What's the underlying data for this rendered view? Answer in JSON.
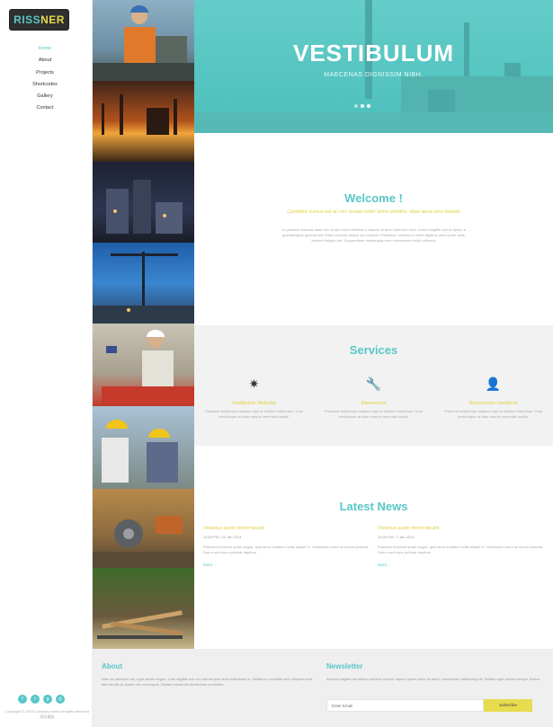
{
  "brand": {
    "part1": "RISS",
    "part2": "NER"
  },
  "nav": [
    "Home",
    "About",
    "Projects",
    "Shortcodes",
    "Gallery",
    "Contact"
  ],
  "social": [
    "f",
    "t",
    "g",
    "◎"
  ],
  "copyright": "Copyright © 2015 Company name All rights reserved 网页模板",
  "hero": {
    "title": "VESTIBULUM",
    "subtitle": "MAECENAS DIGNISSIM NIBH."
  },
  "welcome": {
    "title": "Welcome !",
    "subtitle": "Curabitur cursus est ac nec ornare tortor tortor porttitor, vitae lacus arcu blandit.",
    "body": "In placerat vehicula diam nec ornare tortor eleifend a. Mauris sit amet interdum urna. Donec sagittis cursus ipsum a gravida ligula gravida nisi. Etiam pulvinar neque non semper. Phasellus, vivamus in amet dapibus risus quam vitae, dictum tristique nisl. Suspendisse malesuada urna consectetur mollis vehicula."
  },
  "services": {
    "title": "Services",
    "items": [
      {
        "icon": "✷",
        "title": "Vestibulum Molestie",
        "text": "Praesent vestibulum dapibus nibh ut eleifend bibendum. Cras scelerisque at vitae mauris venenatis mattis."
      },
      {
        "icon": "🔧",
        "title": "Elementum",
        "text": "Praesent vestibulum dapibus nibh ut eleifend bibendum. Cras scelerisque at vitae mauris venenatis mattis."
      },
      {
        "icon": "👤",
        "title": "Nonsectetur Hendrerit",
        "text": "Praesent vestibulum dapibus nibh ut eleifend bibendum. Cras scelerisque at vitae mauris venenatis mattis."
      }
    ]
  },
  "news": {
    "title": "Latest News",
    "items": [
      {
        "title": "Vivamus aucte lorem Iaculis",
        "date": "12:00 PM / 10 Jan 2014",
        "body": "Praesent tincidunt quam augue, quis lacus sodales mollis aliquet in. Vestibulum tortor ac ipsum placerat. Duis a sed risus pulvinar dapibus.",
        "more": "More..."
      },
      {
        "title": "Vivamus aucte lorem Iaculis",
        "date": "12:00 PM / 7 Jan 2014",
        "body": "Praesent tincidunt quam augue, quis lacus sodales mollis aliquet in. Vestibulum tortor ac ipsum placerat. Duis a sed risus pulvinar dapibus.",
        "more": "More..."
      }
    ]
  },
  "footer": {
    "about_title": "About",
    "about_text": "Nam ac interdum dui, eget iaculis augue. Cras sagittis orci nec nisi tempus diam sollicitudin in. Nullam in convallis sem. Aliquam erat felis iaculis ac ipsum nec consequat. Nullam commodo fermentum venenatis.",
    "newsletter_title": "Newsletter",
    "newsletter_text": "Aenean sagittis est aliquet pulvinar cursus, sapien ipsum dolor sit amet, consectetur adipiscing elit. Nullam eget ultrices tempor finibus.",
    "email_placeholder": "Enter Email",
    "subscribe_label": "Subscribe"
  },
  "colors": {
    "accent": "#58c7c6",
    "highlight": "#e0cf3d",
    "hero": "#5ccbc7"
  }
}
